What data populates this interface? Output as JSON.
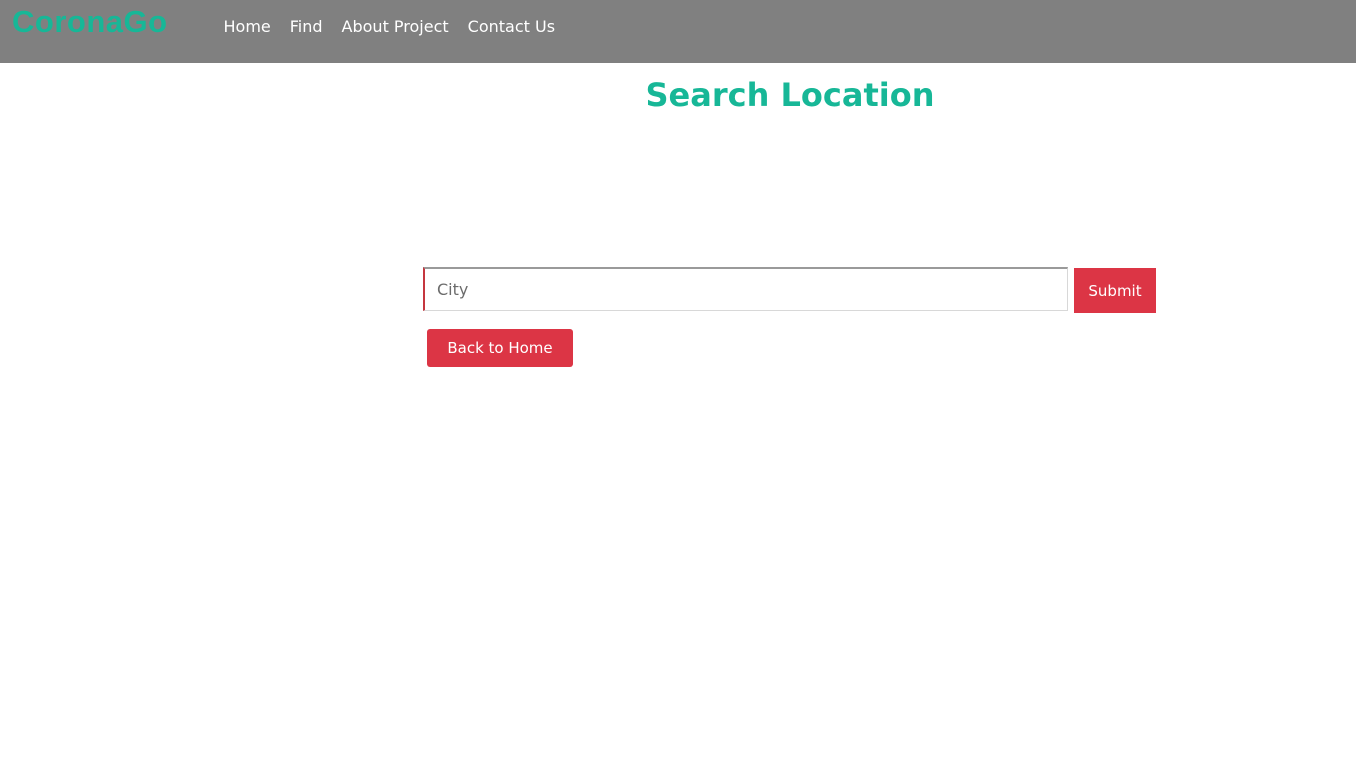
{
  "navbar": {
    "brand": "CoronaGo",
    "links": [
      {
        "label": "Home"
      },
      {
        "label": "Find"
      },
      {
        "label": "About Project"
      },
      {
        "label": "Contact Us"
      }
    ]
  },
  "main": {
    "title": "Search Location",
    "search": {
      "placeholder": "City",
      "value": "",
      "submit_label": "Submit"
    },
    "back_label": "Back to Home"
  },
  "colors": {
    "navbar_bg": "#808080",
    "brand": "#17b797",
    "title": "#17b797",
    "button_bg": "#dc3545"
  }
}
